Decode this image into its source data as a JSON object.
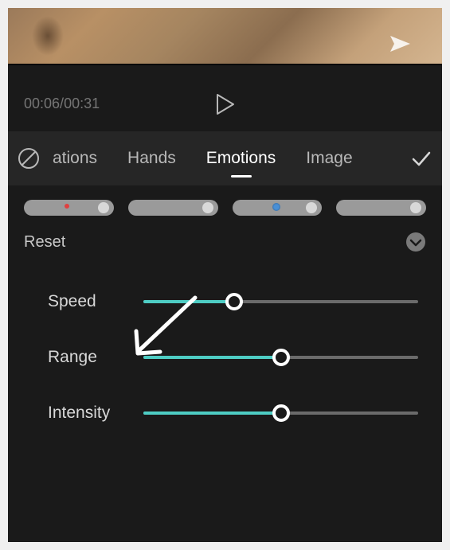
{
  "player": {
    "current_time": "00:06",
    "total_time": "00:31"
  },
  "tabs": {
    "items": [
      {
        "label": "ations",
        "active": false
      },
      {
        "label": "Hands",
        "active": false
      },
      {
        "label": "Emotions",
        "active": true
      },
      {
        "label": "Image",
        "active": false
      }
    ]
  },
  "controls": {
    "reset_label": "Reset",
    "sliders": [
      {
        "name": "Speed",
        "value": 33
      },
      {
        "name": "Range",
        "value": 50
      },
      {
        "name": "Intensity",
        "value": 50
      }
    ]
  },
  "colors": {
    "accent": "#4ecdc4",
    "background": "#1a1a1a",
    "tabbar": "#262626",
    "text_muted": "#757575",
    "text": "#d8d8d8"
  }
}
